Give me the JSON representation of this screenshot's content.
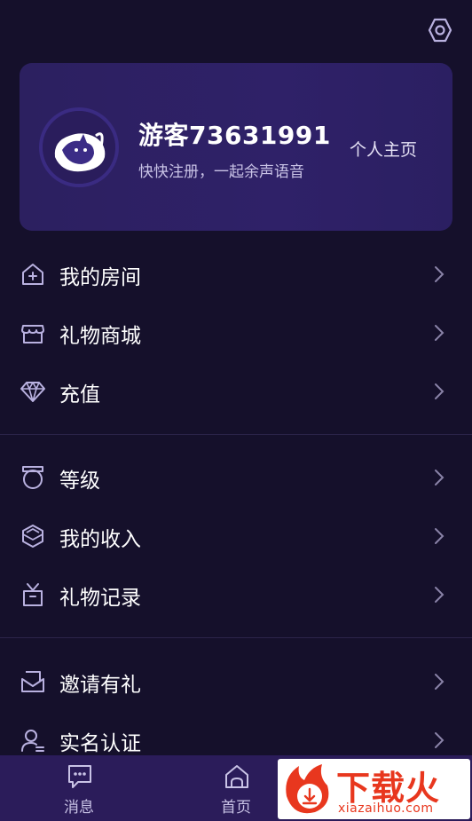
{
  "profile": {
    "username": "游客73631991",
    "slogan": "快快注册，一起余声语音",
    "homepage_label": "个人主页"
  },
  "menu_group_1": [
    {
      "label": "我的房间",
      "icon": "house-icon"
    },
    {
      "label": "礼物商城",
      "icon": "shop-icon"
    },
    {
      "label": "充值",
      "icon": "diamond-icon"
    }
  ],
  "menu_group_2": [
    {
      "label": "等级",
      "icon": "level-badge-icon"
    },
    {
      "label": "我的收入",
      "icon": "income-icon"
    },
    {
      "label": "礼物记录",
      "icon": "gift-box-icon"
    }
  ],
  "menu_group_3": [
    {
      "label": "邀请有礼",
      "icon": "invite-icon"
    },
    {
      "label": "实名认证",
      "icon": "user-verify-icon"
    }
  ],
  "bottom_nav": {
    "messages_label": "消息",
    "home_label": "首页"
  },
  "watermark": {
    "title": "下载火",
    "site": "xiazaihuo.com"
  },
  "colors": {
    "background": "#15102b",
    "card": "#2e2166",
    "bottom_nav": "#2b1c5a",
    "icon_stroke": "#b9b1e0",
    "watermark_red": "#e8371e"
  }
}
